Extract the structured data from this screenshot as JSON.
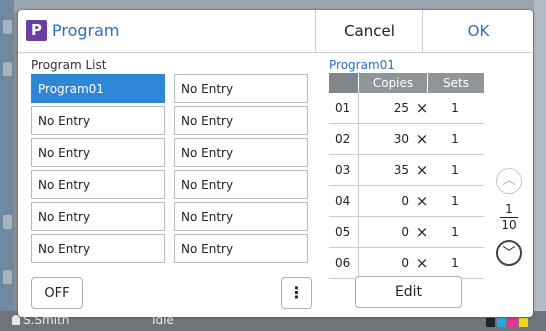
{
  "dialog": {
    "title": "Program",
    "icon_letter": "P",
    "cancel_label": "Cancel",
    "ok_label": "OK"
  },
  "program_list": {
    "label": "Program List",
    "items": [
      {
        "label": "Program01",
        "selected": true
      },
      {
        "label": "No Entry",
        "selected": false
      },
      {
        "label": "No Entry",
        "selected": false
      },
      {
        "label": "No Entry",
        "selected": false
      },
      {
        "label": "No Entry",
        "selected": false
      },
      {
        "label": "No Entry",
        "selected": false
      },
      {
        "label": "No Entry",
        "selected": false
      },
      {
        "label": "No Entry",
        "selected": false
      },
      {
        "label": "No Entry",
        "selected": false
      },
      {
        "label": "No Entry",
        "selected": false
      },
      {
        "label": "No Entry",
        "selected": false
      },
      {
        "label": "No Entry",
        "selected": false
      }
    ],
    "off_label": "OFF",
    "more_label": "⋮"
  },
  "detail": {
    "title": "Program01",
    "columns": [
      "Copies",
      "Sets"
    ],
    "rows": [
      {
        "num": "01",
        "copies": "25",
        "sets": "1"
      },
      {
        "num": "02",
        "copies": "30",
        "sets": "1"
      },
      {
        "num": "03",
        "copies": "35",
        "sets": "1"
      },
      {
        "num": "04",
        "copies": "0",
        "sets": "1"
      },
      {
        "num": "05",
        "copies": "0",
        "sets": "1"
      },
      {
        "num": "06",
        "copies": "0",
        "sets": "1"
      }
    ],
    "times_symbol": "×",
    "page_current": "1",
    "page_total": "10",
    "edit_label": "Edit"
  },
  "background": {
    "user": "S.Smith",
    "status": "Idle"
  },
  "colors": {
    "accent": "#2a6fc0",
    "selected": "#2f86d6",
    "icon_bg": "#6a3fa0"
  }
}
